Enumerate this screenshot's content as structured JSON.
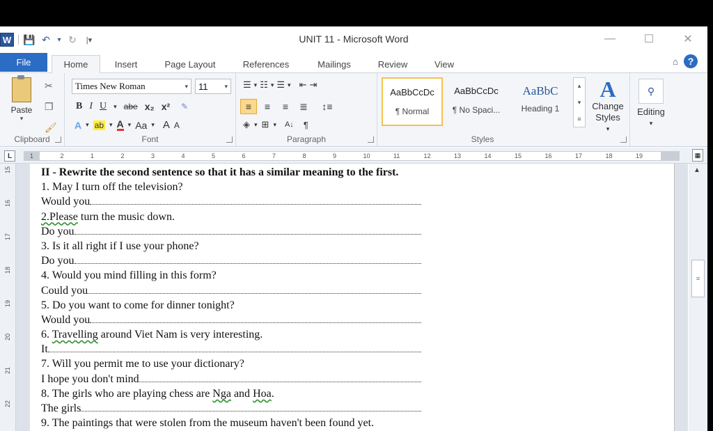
{
  "window": {
    "title": "UNIT 11 - Microsoft Word",
    "app_letter": "W",
    "controls": [
      "—",
      "☐",
      "✕"
    ]
  },
  "qat": {
    "save": "💾",
    "undo": "↶",
    "undo_drop": "▾",
    "redo": "↻",
    "customize": "|▾"
  },
  "tabs": [
    {
      "label": "File"
    },
    {
      "label": "Home"
    },
    {
      "label": "Insert"
    },
    {
      "label": "Page Layout"
    },
    {
      "label": "References"
    },
    {
      "label": "Mailings"
    },
    {
      "label": "Review"
    },
    {
      "label": "View"
    }
  ],
  "help": {
    "minimize": "⌂",
    "help": "?"
  },
  "ribbon": {
    "clipboard": {
      "label": "Clipboard",
      "paste": "Paste",
      "paste_caret": "▾"
    },
    "font": {
      "label": "Font",
      "font_name": "Times New Roman",
      "font_size": "11",
      "row2": [
        "B",
        "I",
        "U",
        "▾",
        "abe",
        "x₂",
        "x²"
      ],
      "row3": [
        "A",
        "▾",
        "ab",
        "▾",
        "A",
        "▾",
        "Aa",
        "▾",
        "A",
        "A"
      ]
    },
    "paragraph": {
      "label": "Paragraph",
      "row1": [
        "☰",
        "▾",
        "☷",
        "▾",
        "☰",
        "▾",
        "⇤",
        "⇥"
      ],
      "row3": [
        "▾",
        "⊞",
        "▾",
        "A↓",
        "¶"
      ]
    },
    "styles": {
      "label": "Styles",
      "items": [
        {
          "sample": "AaBbCcDc",
          "name": "¶ Normal"
        },
        {
          "sample": "AaBbCcDc",
          "name": "¶ No Spaci..."
        },
        {
          "sample": "AaBbC",
          "name": "Heading 1"
        }
      ],
      "change_styles": "Change Styles",
      "change_caret": "▾"
    },
    "editing": {
      "label": "Editing",
      "caret": "▾"
    }
  },
  "ruler": {
    "corner": "L",
    "marks": [
      "1",
      "2",
      "1",
      "2",
      "3",
      "4",
      "5",
      "6",
      "7",
      "8",
      "9",
      "10",
      "11",
      "12",
      "13",
      "14",
      "15",
      "16",
      "17",
      "18",
      "19"
    ]
  },
  "vruler": {
    "marks": [
      "15",
      "16",
      "17",
      "18",
      "19",
      "20",
      "21",
      "22"
    ]
  },
  "document": {
    "heading": "II - Rewrite the second sentence so that it has a similar meaning to the first.",
    "items": [
      {
        "q": "1. May I turn off the television?",
        "a": "Would you"
      },
      {
        "q": "2.Please turn the music down.",
        "a": "Do you"
      },
      {
        "q": "3. Is it all right if I use your phone?",
        "a": "Do you"
      },
      {
        "q": "4. Would you mind filling in this form?",
        "a": "Could you"
      },
      {
        "q": "5. Do you want to come for dinner tonight?",
        "a": "Would you"
      },
      {
        "q": "6. Travelling around Viet Nam is very interesting.",
        "a": "It"
      },
      {
        "q": "7. Will you permit me to use your dictionary?",
        "a": "I hope you don't mind"
      },
      {
        "q": "8. The girls who are playing chess are Nga and Hoa.",
        "a": "The girls"
      },
      {
        "q": "9. The paintings that were stolen from the museum haven't been found yet.",
        "a": ""
      }
    ]
  },
  "scroll": {
    "up": "▲",
    "thumb": "≡"
  }
}
